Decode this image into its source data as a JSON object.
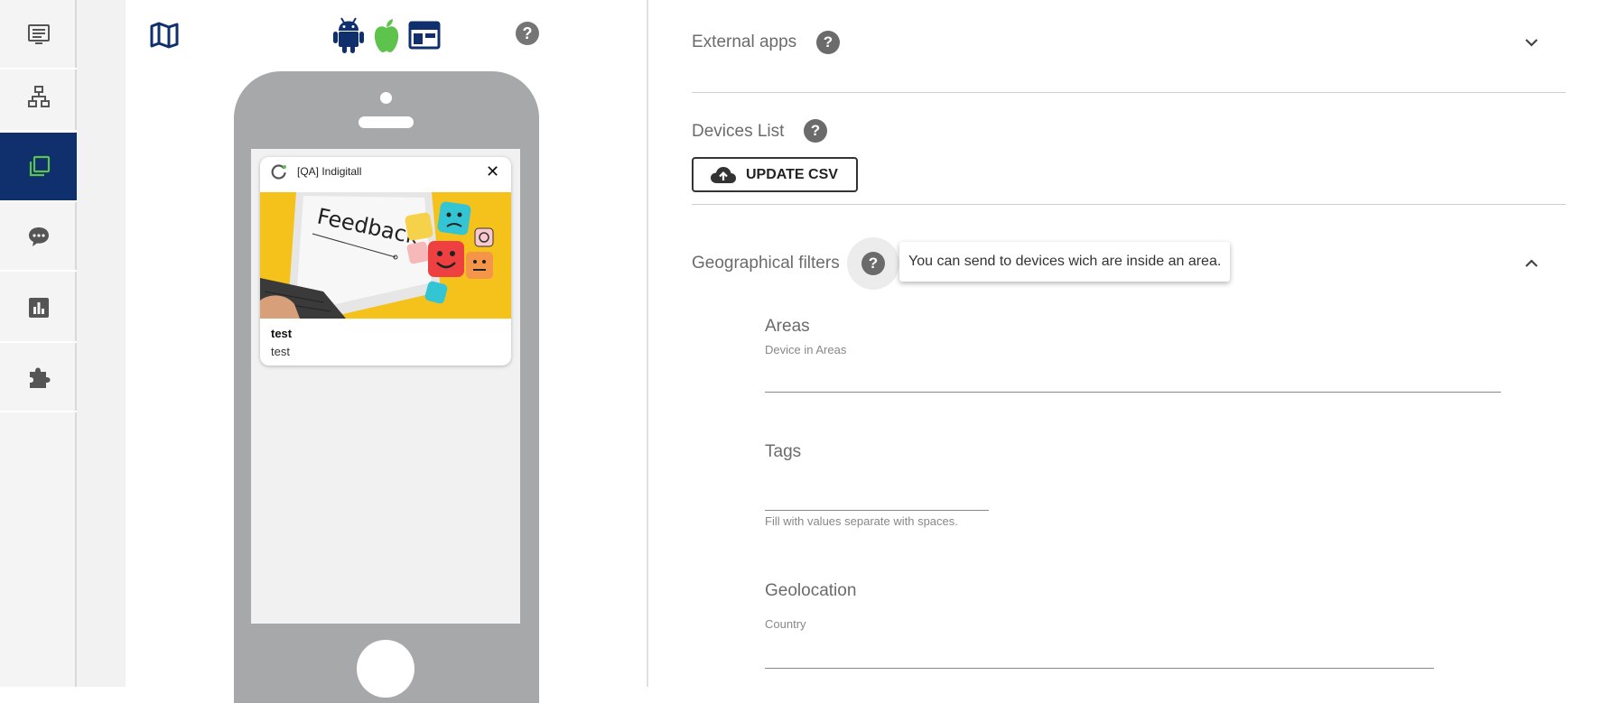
{
  "nav": {
    "items": [
      {
        "icon": "list-icon",
        "active": false
      },
      {
        "icon": "sitemap-icon",
        "active": false
      },
      {
        "icon": "layers-icon",
        "active": true
      },
      {
        "icon": "chat-icon",
        "active": false
      },
      {
        "icon": "chart-icon",
        "active": false
      },
      {
        "icon": "puzzle-icon",
        "active": false
      }
    ],
    "active_color": "#0f2f6d",
    "accent_color": "#5dc34c"
  },
  "preview": {
    "help_symbol": "?",
    "os_icons": [
      "android-icon",
      "apple-icon",
      "web-browser-icon"
    ],
    "notification": {
      "app_name": "[QA] Indigitall",
      "close_symbol": "✕",
      "image_text": "Feedback",
      "title": "test",
      "body": "test"
    }
  },
  "form": {
    "external_apps": {
      "label": "External apps",
      "help": "?"
    },
    "devices_list": {
      "label": "Devices List",
      "help": "?",
      "button_label": "UPDATE CSV"
    },
    "geo_filters": {
      "label": "Geographical filters",
      "help": "?",
      "tooltip": "You can send to devices wich are inside an area."
    },
    "areas": {
      "label": "Areas",
      "sublabel": "Device in Areas",
      "value": ""
    },
    "tags": {
      "label": "Tags",
      "hint": "Fill with values separate with spaces.",
      "value": ""
    },
    "geolocation": {
      "label": "Geolocation",
      "country_label": "Country",
      "value": ""
    }
  }
}
